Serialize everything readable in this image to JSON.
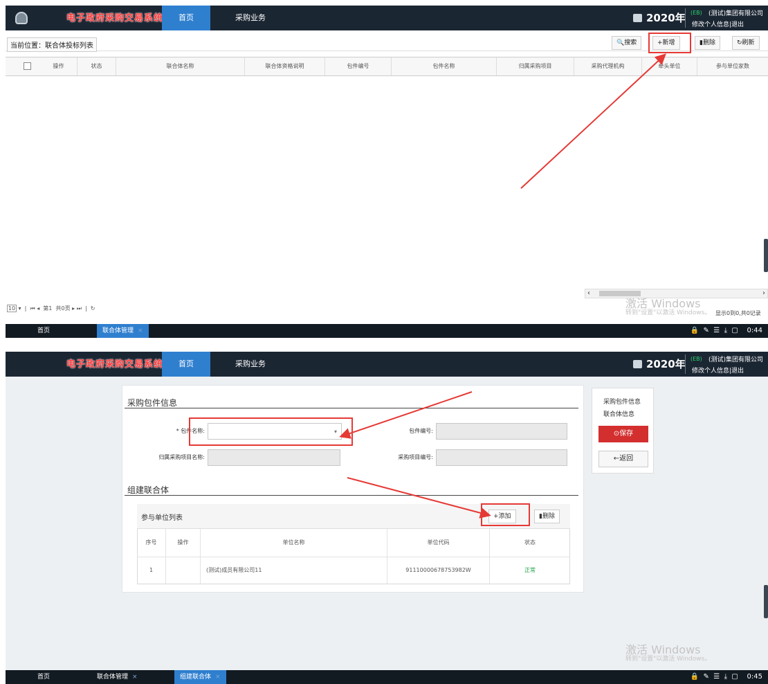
{
  "app": {
    "brand": "电子政府采购交易系统",
    "year": "2020年",
    "user_badge": "(EB)",
    "org": "(测试)集团有限公司",
    "user_links": "修改个人信息|退出",
    "nav": {
      "home": "首页",
      "business": "采购业务"
    }
  },
  "list_page": {
    "breadcrumb": "当前位置：联合体投标列表",
    "toolbar": {
      "search": "搜索",
      "add": "+新增",
      "delete": "删除",
      "refresh": "刷新"
    },
    "columns": [
      "操作",
      "状态",
      "联合体名称",
      "联合体资格说明",
      "包件编号",
      "包件名称",
      "归属采购项目",
      "采购代理机构",
      "牵头单位",
      "参与单位家数"
    ],
    "pager": {
      "page_size": "10",
      "page_label": "第1",
      "total_label": "共0页"
    },
    "record_info": "显示0到0,共0记录",
    "watermark_title": "激活 Windows",
    "watermark_hint": "转到\"设置\"以激活 Windows。",
    "taskbar": {
      "home": "首页",
      "tab1": "联合体管理",
      "clock": "0:44"
    }
  },
  "form_page": {
    "section1": "采购包件信息",
    "label_package_name": "* 包件名称:",
    "label_package_no": "包件编号:",
    "label_project_name": "归属采购项目名称:",
    "label_project_no": "采购项目编号:",
    "section2": "组建联合体",
    "participants_title": "参与单位列表",
    "add_button": "+添加",
    "delete_button": "删除",
    "table_headers": [
      "序号",
      "操作",
      "单位名称",
      "单位代码",
      "状态"
    ],
    "rows": [
      {
        "index": "1",
        "op": "",
        "name": "(测试)成员有限公司11",
        "code": "91110000678753982W",
        "status": "正常"
      }
    ],
    "side": {
      "link1": "采购包件信息",
      "link2": "联合体信息",
      "save": "保存",
      "back": "←返回"
    },
    "watermark_title": "激活 Windows",
    "watermark_hint": "转到\"设置\"以激活 Windows。",
    "taskbar": {
      "home": "首页",
      "tab1": "联合体管理",
      "tab2": "组建联合体",
      "clock": "0:45"
    }
  },
  "icons": [
    "app-logo-icon",
    "calendar-icon",
    "search-icon",
    "delete-icon",
    "refresh-icon",
    "dropdown-caret-icon",
    "save-icon",
    "lock-icon",
    "pin-icon",
    "download-icon",
    "window-icon"
  ],
  "colors": {
    "topbar": "#1b2633",
    "nav_active": "#2f7fcf",
    "highlight": "#e53935",
    "save": "#d32f2f",
    "status_ok": "#1fa14a"
  }
}
